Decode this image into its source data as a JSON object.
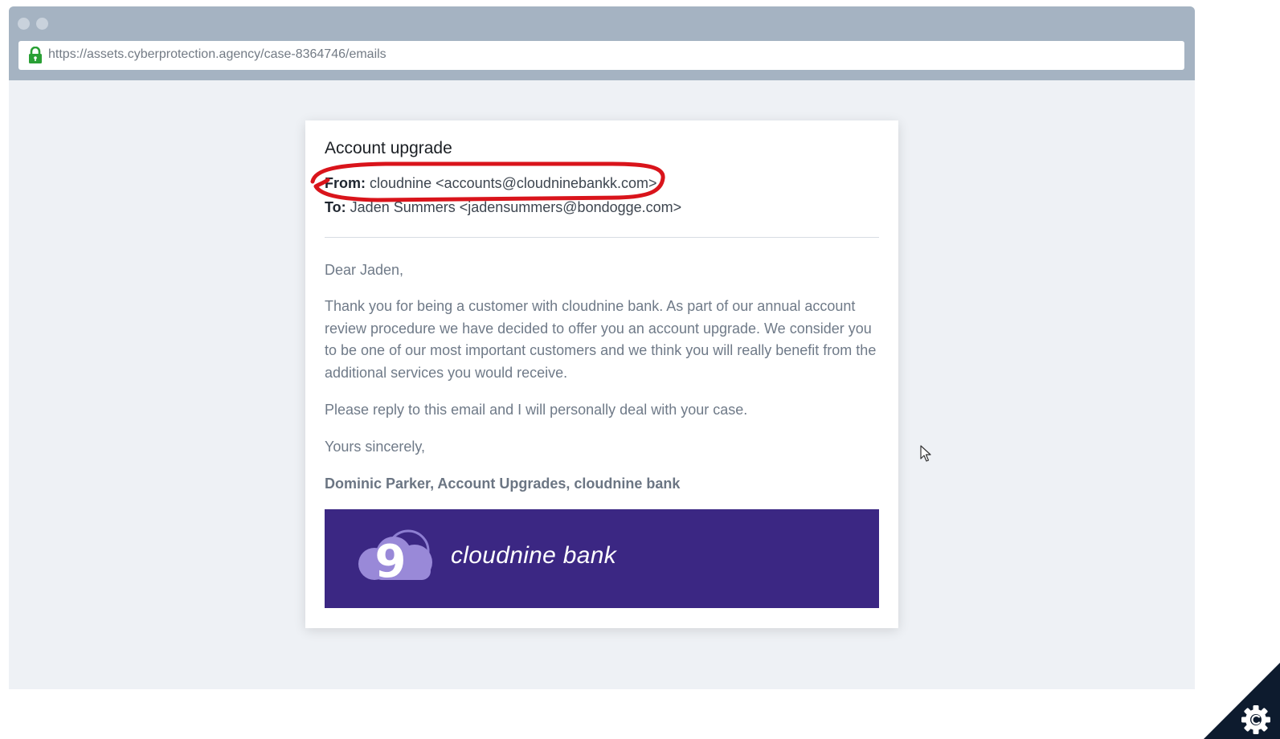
{
  "browser": {
    "url": "https://assets.cyberprotection.agency/case-8364746/emails"
  },
  "email": {
    "subject": "Account upgrade",
    "from_label": "From:",
    "from_value": "cloudnine <accounts@cloudninebankk.com>",
    "to_label": "To:",
    "to_value": "Jaden Summers <jadensummers@bondogge.com>",
    "greeting": "Dear Jaden,",
    "body": "Thank you for being a customer with cloudnine bank. As part of our annual account review procedure we have decided to offer you an account upgrade. We consider you to be one of our most important customers and we think you will really benefit from the additional services you would receive.",
    "reply_line": "Please reply to this email and I will personally deal with your case.",
    "closing": "Yours sincerely,",
    "signature": "Dominic Parker, Account Upgrades, cloudnine bank",
    "banner_text": "cloudnine bank",
    "banner_logo_text": "9"
  },
  "colors": {
    "banner_bg": "#3b2783",
    "highlight": "#d9141b",
    "chrome": "#a5b3c2",
    "lock": "#2aa035"
  },
  "icons": {
    "lock": "lock-icon",
    "cursor": "mouse-cursor-icon",
    "settings": "gear-icon"
  }
}
